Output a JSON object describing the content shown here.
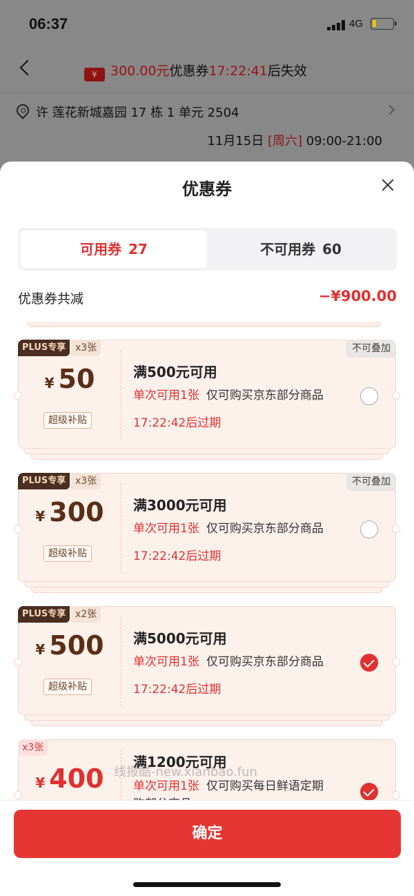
{
  "status": {
    "time": "06:37",
    "network": "4G"
  },
  "nav": {
    "ticket_symbol": "¥",
    "amount": "300.00元",
    "coupon_text": "优惠券",
    "countdown": "17:22:41",
    "suffix": "后失效"
  },
  "address": {
    "text": "许  莲花新城嘉园 17 栋 1 单元 2504"
  },
  "delivery": {
    "date": "11月15日",
    "weekday": "[周六]",
    "hours": "09:00-21:00"
  },
  "sheet": {
    "title": "优惠券",
    "tabs": [
      {
        "label": "可用券",
        "count": "27"
      },
      {
        "label": "不可用券",
        "count": "60"
      }
    ],
    "total_label": "优惠券共减",
    "total_amount": "−¥900.00"
  },
  "coupons": [
    {
      "plus": "PLUS专享",
      "count": "x3张",
      "stack": "不可叠加",
      "yen": "¥",
      "value": "50",
      "subsidy": "超级补贴",
      "title": "满500元可用",
      "once": "单次可用1张",
      "scope": "仅可购买京东部分商品",
      "expire": "17:22:42后过期",
      "checked": false
    },
    {
      "plus": "PLUS专享",
      "count": "x3张",
      "stack": "不可叠加",
      "yen": "¥",
      "value": "300",
      "subsidy": "超级补贴",
      "title": "满3000元可用",
      "once": "单次可用1张",
      "scope": "仅可购买京东部分商品",
      "expire": "17:22:42后过期",
      "checked": false
    },
    {
      "plus": "PLUS专享",
      "count": "x2张",
      "stack": "",
      "yen": "¥",
      "value": "500",
      "subsidy": "超级补贴",
      "title": "满5000元可用",
      "once": "单次可用1张",
      "scope": "仅可购买京东部分商品",
      "expire": "17:22:42后过期",
      "checked": true
    },
    {
      "plus": "",
      "count": "x3张",
      "stack": "",
      "yen": "¥",
      "value": "400",
      "subsidy": "",
      "title": "满1200元可用",
      "once": "单次可用1张",
      "scope": "仅可购买每日鲜语定期",
      "scope2": "购部分商品",
      "expire": "",
      "checked": true
    }
  ],
  "watermark": "线报酷-new.xianbao.fun",
  "footer": {
    "confirm_label": "确定"
  }
}
